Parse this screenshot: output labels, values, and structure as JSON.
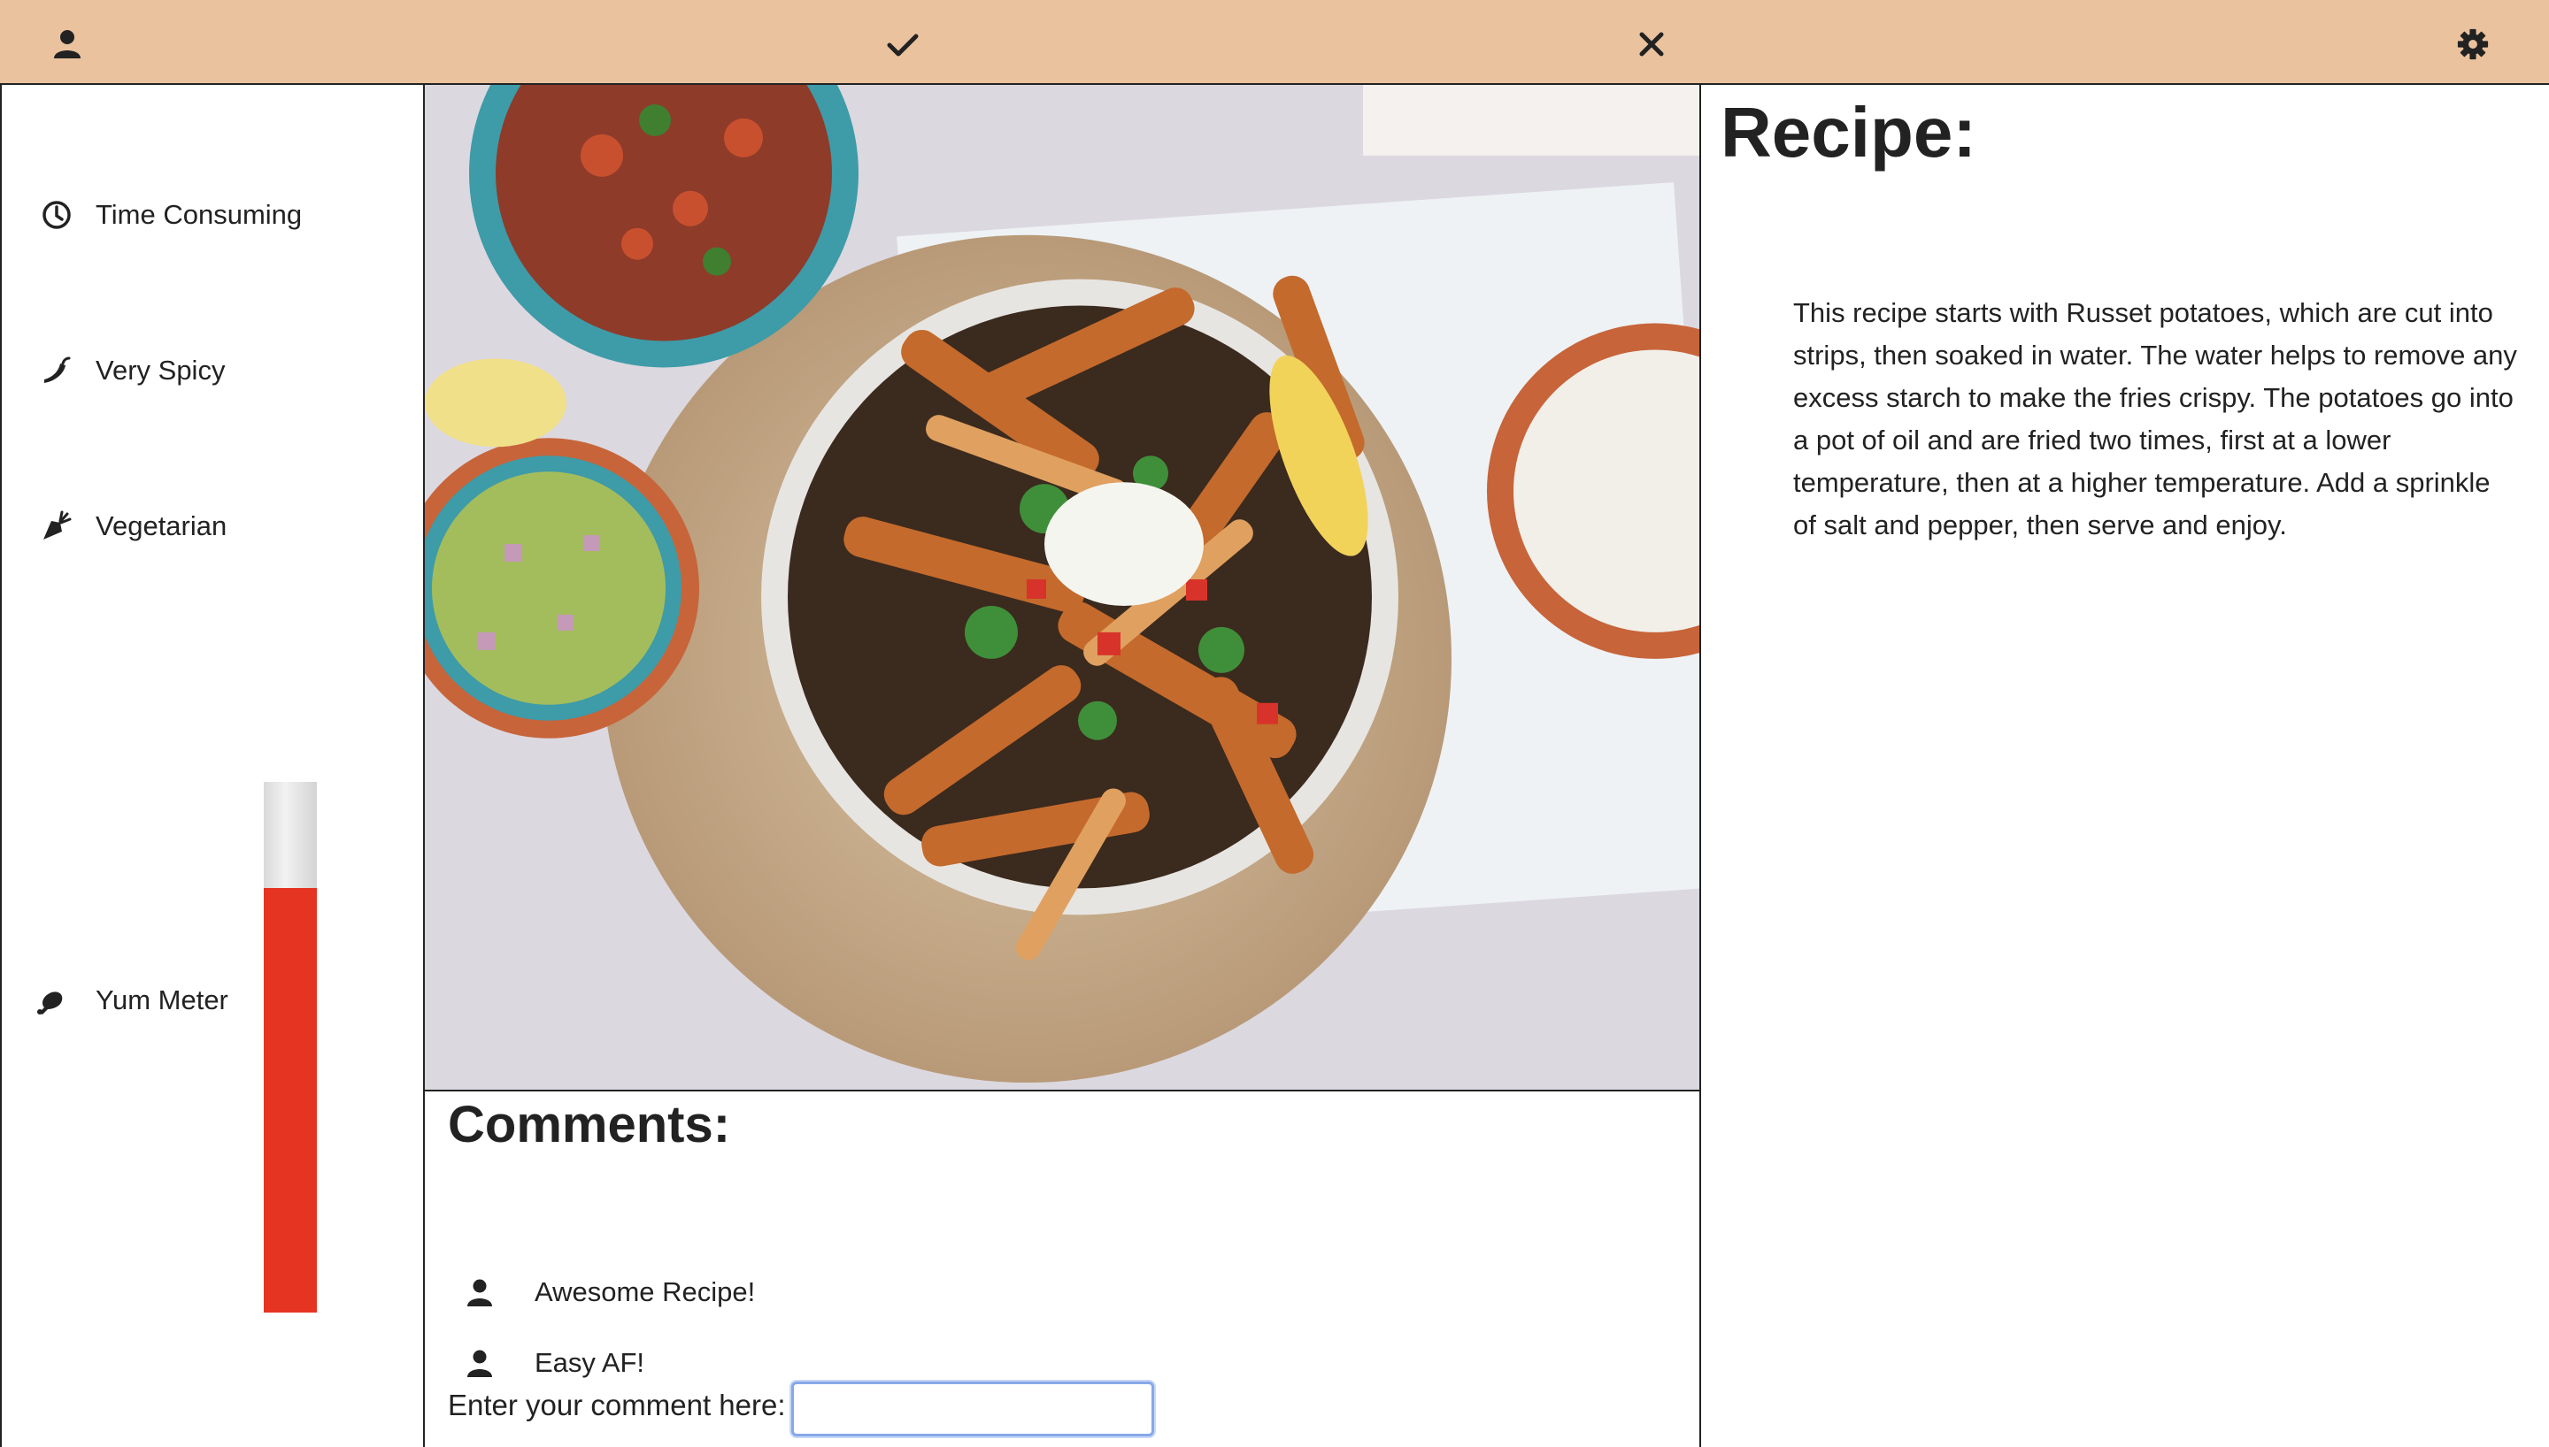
{
  "topbar": {
    "icons": [
      "user-icon",
      "check-icon",
      "close-icon",
      "gear-icon"
    ]
  },
  "sidebar": {
    "attributes": [
      {
        "label": "Time Consuming",
        "icon": "clock-icon"
      },
      {
        "label": "Very Spicy",
        "icon": "pepper-icon"
      },
      {
        "label": "Vegetarian",
        "icon": "carrot-icon"
      }
    ],
    "yum_meter": {
      "label": "Yum Meter",
      "icon": "drumstick-icon",
      "level_fraction": 0.8,
      "fill_color": "#e63422"
    }
  },
  "comments": {
    "title": "Comments:",
    "items": [
      {
        "text": "Awesome Recipe!",
        "icon": "user-icon"
      },
      {
        "text": "Easy AF!",
        "icon": "user-icon"
      }
    ],
    "entry_label": "Enter your comment here:",
    "entry_value": ""
  },
  "recipe": {
    "title": "Recipe:",
    "text": "This recipe starts with Russet potatoes, which are cut into strips, then soaked in water. The water helps to remove any excess starch to make the fries crispy. The potatoes go into a pot of oil and are fried two times, first at a lower temperature, then at a higher temperature. Add a sprinkle of salt and pepper, then serve and enjoy."
  },
  "colors": {
    "topbar": "#eac29e",
    "accent": "#e63422"
  }
}
